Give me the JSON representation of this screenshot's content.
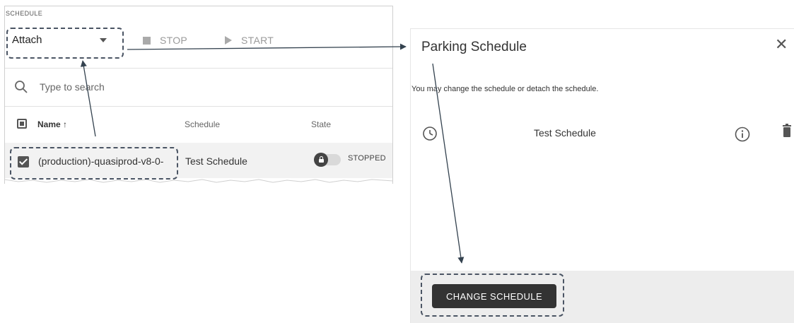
{
  "schedule_panel": {
    "section_label": "SCHEDULE",
    "select_value": "Attach",
    "stop_label": "STOP",
    "start_label": "START",
    "search_placeholder": "Type to search",
    "columns": [
      "Name ↑",
      "Schedule",
      "State"
    ],
    "row": {
      "name": "(production)-quasiprod-v8-0-",
      "schedule": "Test Schedule",
      "state": "STOPPED"
    }
  },
  "parking_dialog": {
    "title": "Parking Schedule",
    "description": "You may change the schedule or detach the schedule.",
    "schedule_name": "Test Schedule",
    "change_button": "CHANGE SCHEDULE"
  },
  "icons": {
    "close": "close-icon",
    "search": "search-icon",
    "clock": "clock-icon",
    "info": "info-icon",
    "trash": "trash-icon",
    "lock": "lock-icon"
  }
}
